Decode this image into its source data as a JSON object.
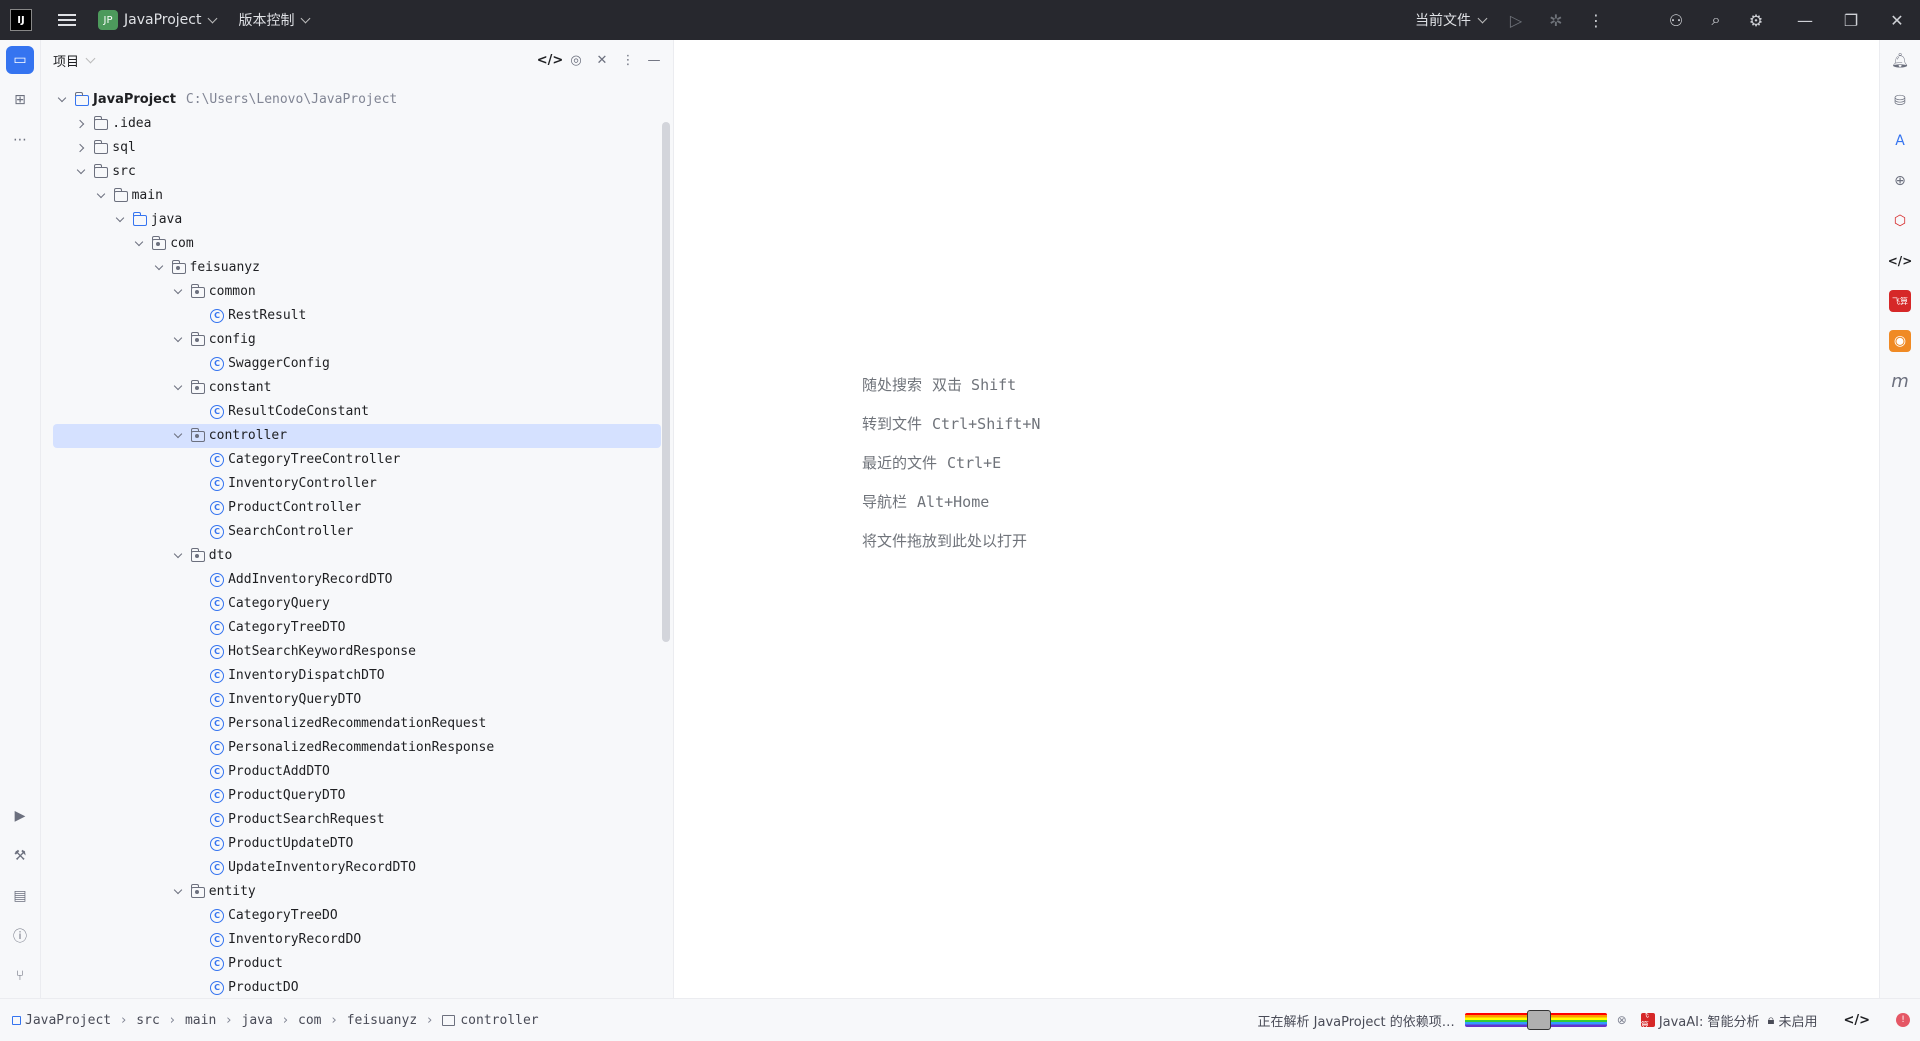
{
  "titlebar": {
    "logo_text": "IJ",
    "project_badge": "JP",
    "project_name": "JavaProject",
    "vcs_label": "版本控制",
    "current_file_label": "当前文件"
  },
  "project_panel": {
    "title": "项目"
  },
  "tree": {
    "root": {
      "label": "JavaProject",
      "path": "C:\\Users\\Lenovo\\JavaProject"
    },
    "items": [
      {
        "label": ".idea",
        "type": "folder",
        "state": "closed"
      },
      {
        "label": "sql",
        "type": "folder",
        "state": "closed"
      },
      {
        "label": "src",
        "type": "folder",
        "state": "open"
      },
      {
        "label": "main",
        "type": "folder",
        "state": "open"
      },
      {
        "label": "java",
        "type": "source-folder",
        "state": "open"
      },
      {
        "label": "com",
        "type": "package",
        "state": "open"
      },
      {
        "label": "feisuanyz",
        "type": "package",
        "state": "open"
      },
      {
        "label": "common",
        "type": "package",
        "state": "open"
      },
      {
        "label": "RestResult",
        "type": "class"
      },
      {
        "label": "config",
        "type": "package",
        "state": "open"
      },
      {
        "label": "SwaggerConfig",
        "type": "class"
      },
      {
        "label": "constant",
        "type": "package",
        "state": "open"
      },
      {
        "label": "ResultCodeConstant",
        "type": "class"
      },
      {
        "label": "controller",
        "type": "package",
        "state": "open",
        "selected": true
      },
      {
        "label": "CategoryTreeController",
        "type": "class"
      },
      {
        "label": "InventoryController",
        "type": "class"
      },
      {
        "label": "ProductController",
        "type": "class"
      },
      {
        "label": "SearchController",
        "type": "class"
      },
      {
        "label": "dto",
        "type": "package",
        "state": "open"
      },
      {
        "label": "AddInventoryRecordDTO",
        "type": "class"
      },
      {
        "label": "CategoryQuery",
        "type": "class"
      },
      {
        "label": "CategoryTreeDTO",
        "type": "class"
      },
      {
        "label": "HotSearchKeywordResponse",
        "type": "class"
      },
      {
        "label": "InventoryDispatchDTO",
        "type": "class"
      },
      {
        "label": "InventoryQueryDTO",
        "type": "class"
      },
      {
        "label": "PersonalizedRecommendationRequest",
        "type": "class"
      },
      {
        "label": "PersonalizedRecommendationResponse",
        "type": "class"
      },
      {
        "label": "ProductAddDTO",
        "type": "class"
      },
      {
        "label": "ProductQueryDTO",
        "type": "class"
      },
      {
        "label": "ProductSearchRequest",
        "type": "class"
      },
      {
        "label": "ProductUpdateDTO",
        "type": "class"
      },
      {
        "label": "UpdateInventoryRecordDTO",
        "type": "class"
      },
      {
        "label": "entity",
        "type": "package",
        "state": "open"
      },
      {
        "label": "CategoryTreeDO",
        "type": "class"
      },
      {
        "label": "InventoryRecordDO",
        "type": "class"
      },
      {
        "label": "Product",
        "type": "class"
      },
      {
        "label": "ProductDO",
        "type": "class"
      }
    ]
  },
  "editor_hints": [
    {
      "label": "随处搜索",
      "key": "双击 Shift"
    },
    {
      "label": "转到文件",
      "key": "Ctrl+Shift+N"
    },
    {
      "label": "最近的文件",
      "key": "Ctrl+E"
    },
    {
      "label": "导航栏",
      "key": "Alt+Home"
    },
    {
      "label": "将文件拖放到此处以打开",
      "key": ""
    }
  ],
  "breadcrumbs": [
    "JavaProject",
    "src",
    "main",
    "java",
    "com",
    "feisuanyz",
    "controller"
  ],
  "status": {
    "progress_text": "正在解析 JavaProject 的依赖项…",
    "javaai_label": "JavaAI: 智能分析",
    "disabled_label": "未启用",
    "badge_text": "飞算"
  },
  "colors": {
    "accent": "#3574f0",
    "selection": "#d5e1ff",
    "titlebar": "#27282e"
  }
}
